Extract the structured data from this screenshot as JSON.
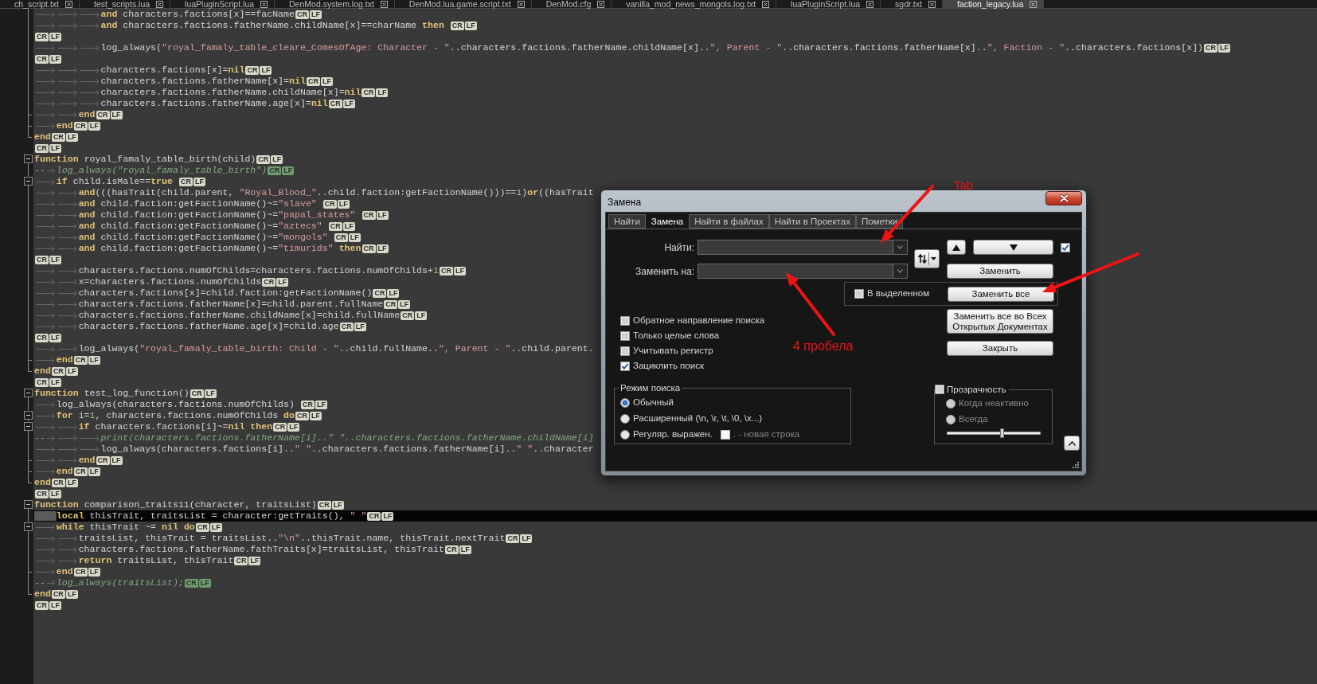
{
  "tabs": [
    {
      "label": "ch_script.txt",
      "selected": false
    },
    {
      "label": "test_scripts.lua",
      "selected": false
    },
    {
      "label": "luaPluginScript.lua",
      "selected": false
    },
    {
      "label": "DenMod.system.log.txt",
      "selected": false
    },
    {
      "label": "DenMod.lua.game.script.txt",
      "selected": false
    },
    {
      "label": "DenMod.cfg",
      "selected": false
    },
    {
      "label": "vanilla_mod_news_mongols.log.txt",
      "selected": false
    },
    {
      "label": "luaPluginScript.lua",
      "selected": false
    },
    {
      "label": "sgdr.txt",
      "selected": false
    },
    {
      "label": "faction_legacy.lua",
      "selected": true
    }
  ],
  "editor": {
    "lines": [
      {
        "kind": "code",
        "fold": {
          "kind": "guide"
        },
        "current": false,
        "tokens": [
          {
            "kind": "keyword",
            "text": "\t\t\tand"
          },
          {
            "kind": "plain",
            "text": " characters.factions[x]==facName"
          }
        ],
        "eol": [
          "CR",
          "LF"
        ]
      },
      {
        "kind": "code",
        "fold": {
          "kind": "guide"
        },
        "current": false,
        "tokens": [
          {
            "kind": "keyword",
            "text": "\t\t\tand"
          },
          {
            "kind": "plain",
            "text": " characters.factions.fatherName.childName[x]==charName "
          },
          {
            "kind": "keyword",
            "text": "then "
          }
        ],
        "eol": [
          "CR",
          "LF"
        ]
      },
      {
        "kind": "code",
        "fold": {
          "kind": "guide"
        },
        "current": false,
        "eol": [
          "CR",
          "LF"
        ]
      },
      {
        "kind": "code",
        "fold": {
          "kind": "guide"
        },
        "current": false,
        "tokens": [
          {
            "kind": "plain",
            "text": "\t\t\tlog_always("
          },
          {
            "kind": "string",
            "text": "\"royal_famaly_table_cleare_ComesOfAge: Character - \""
          },
          {
            "kind": "plain",
            "text": "..characters.factions.fatherName.childName[x].."
          },
          {
            "kind": "string",
            "text": "\", Parent - \""
          },
          {
            "kind": "plain",
            "text": "..characters.factions.fatherName[x].."
          },
          {
            "kind": "string",
            "text": "\", Faction - \""
          },
          {
            "kind": "plain",
            "text": "..characters.factions[x])"
          }
        ],
        "eol": [
          "CR",
          "LF"
        ]
      },
      {
        "kind": "code",
        "fold": {
          "kind": "guide"
        },
        "current": false,
        "eol": [
          "CR",
          "LF"
        ]
      },
      {
        "kind": "code",
        "fold": {
          "kind": "guide"
        },
        "current": false,
        "tokens": [
          {
            "kind": "plain",
            "text": "\t\t\tcharacters.factions[x]="
          },
          {
            "kind": "keyword",
            "text": "nil"
          }
        ],
        "eol": [
          "CR",
          "LF"
        ]
      },
      {
        "kind": "code",
        "fold": {
          "kind": "guide"
        },
        "current": false,
        "tokens": [
          {
            "kind": "plain",
            "text": "\t\t\tcharacters.factions.fatherName[x]="
          },
          {
            "kind": "keyword",
            "text": "nil"
          }
        ],
        "eol": [
          "CR",
          "LF"
        ]
      },
      {
        "kind": "code",
        "fold": {
          "kind": "guide"
        },
        "current": false,
        "tokens": [
          {
            "kind": "plain",
            "text": "\t\t\tcharacters.factions.fatherName.childName[x]="
          },
          {
            "kind": "keyword",
            "text": "nil"
          }
        ],
        "eol": [
          "CR",
          "LF"
        ]
      },
      {
        "kind": "code",
        "fold": {
          "kind": "guide"
        },
        "current": false,
        "tokens": [
          {
            "kind": "plain",
            "text": "\t\t\tcharacters.factions.fatherName.age[x]="
          },
          {
            "kind": "keyword",
            "text": "nil"
          }
        ],
        "eol": [
          "CR",
          "LF"
        ]
      },
      {
        "kind": "code",
        "fold": {
          "kind": "guide_tick"
        },
        "current": false,
        "tokens": [
          {
            "kind": "keyword",
            "text": "\t\tend"
          }
        ],
        "eol": [
          "CR",
          "LF"
        ]
      },
      {
        "kind": "code",
        "fold": {
          "kind": "guide_tick"
        },
        "current": false,
        "tokens": [
          {
            "kind": "keyword",
            "text": "\tend"
          }
        ],
        "eol": [
          "CR",
          "LF"
        ]
      },
      {
        "kind": "code",
        "fold": {
          "kind": "guide_end"
        },
        "current": false,
        "tokens": [
          {
            "kind": "keyword",
            "text": "end"
          }
        ],
        "eol": [
          "CR",
          "LF"
        ]
      },
      {
        "kind": "code",
        "current": false,
        "eol": [
          "CR",
          "LF"
        ]
      },
      {
        "kind": "code",
        "fold": {
          "kind": "collapse"
        },
        "current": false,
        "tokens": [
          {
            "kind": "keyword",
            "text": "function"
          },
          {
            "kind": "plain",
            "text": " royal_famaly_table_birth(child)"
          }
        ],
        "eol": [
          "CR",
          "LF"
        ]
      },
      {
        "kind": "comment",
        "fold": {
          "kind": "guide"
        },
        "current": false,
        "tokens": [
          {
            "kind": "comment",
            "text": "--\tlog_always(\"royal_famaly_table_birth\")"
          }
        ],
        "eol": [
          "CR",
          "LF"
        ]
      },
      {
        "kind": "code",
        "fold": {
          "kind": "collapse"
        },
        "current": false,
        "tokens": [
          {
            "kind": "keyword",
            "text": "\tif"
          },
          {
            "kind": "plain",
            "text": " child.isMale=="
          },
          {
            "kind": "keyword",
            "text": "true "
          }
        ],
        "eol": [
          "CR",
          "LF"
        ]
      },
      {
        "kind": "code",
        "fold": {
          "kind": "guide"
        },
        "current": false,
        "tokens": [
          {
            "kind": "keyword",
            "text": "\t\tand"
          },
          {
            "kind": "plain",
            "text": "(((hasTrait(child.parent, "
          },
          {
            "kind": "string",
            "text": "\"Royal_Blood_\""
          },
          {
            "kind": "plain",
            "text": "..child.faction:getFactionName()))=="
          },
          {
            "kind": "number",
            "text": "1"
          },
          {
            "kind": "plain",
            "text": ")"
          },
          {
            "kind": "keyword",
            "text": "or"
          },
          {
            "kind": "plain",
            "text": "((hasTrait"
          }
        ]
      },
      {
        "kind": "code",
        "fold": {
          "kind": "guide"
        },
        "current": false,
        "tokens": [
          {
            "kind": "keyword",
            "text": "\t\tand"
          },
          {
            "kind": "plain",
            "text": " child.faction:getFactionName()~="
          },
          {
            "kind": "string",
            "text": "\"slave\" "
          }
        ],
        "eol": [
          "CR",
          "LF"
        ]
      },
      {
        "kind": "code",
        "fold": {
          "kind": "guide"
        },
        "current": false,
        "tokens": [
          {
            "kind": "keyword",
            "text": "\t\tand"
          },
          {
            "kind": "plain",
            "text": " child.faction:getFactionName()~="
          },
          {
            "kind": "string",
            "text": "\"papal_states\" "
          }
        ],
        "eol": [
          "CR",
          "LF"
        ]
      },
      {
        "kind": "code",
        "fold": {
          "kind": "guide"
        },
        "current": false,
        "tokens": [
          {
            "kind": "keyword",
            "text": "\t\tand"
          },
          {
            "kind": "plain",
            "text": " child.faction:getFactionName()~="
          },
          {
            "kind": "string",
            "text": "\"aztecs\" "
          }
        ],
        "eol": [
          "CR",
          "LF"
        ]
      },
      {
        "kind": "code",
        "fold": {
          "kind": "guide"
        },
        "current": false,
        "tokens": [
          {
            "kind": "keyword",
            "text": "\t\tand"
          },
          {
            "kind": "plain",
            "text": " child.faction:getFactionName()~="
          },
          {
            "kind": "string",
            "text": "\"mongols\" "
          }
        ],
        "eol": [
          "CR",
          "LF"
        ]
      },
      {
        "kind": "code",
        "fold": {
          "kind": "guide"
        },
        "current": false,
        "tokens": [
          {
            "kind": "keyword",
            "text": "\t\tand"
          },
          {
            "kind": "plain",
            "text": " child.faction:getFactionName()~="
          },
          {
            "kind": "string",
            "text": "\"timurids\" "
          },
          {
            "kind": "keyword",
            "text": "then"
          }
        ],
        "eol": [
          "CR",
          "LF"
        ]
      },
      {
        "kind": "code",
        "fold": {
          "kind": "guide"
        },
        "current": false,
        "eol": [
          "CR",
          "LF"
        ]
      },
      {
        "kind": "code",
        "fold": {
          "kind": "guide"
        },
        "current": false,
        "tokens": [
          {
            "kind": "plain",
            "text": "\t\tcharacters.factions.numOfChilds=characters.factions.numOfChilds+"
          },
          {
            "kind": "number",
            "text": "1"
          }
        ],
        "eol": [
          "CR",
          "LF"
        ]
      },
      {
        "kind": "code",
        "fold": {
          "kind": "guide"
        },
        "current": false,
        "tokens": [
          {
            "kind": "plain",
            "text": "\t\tx=characters.factions.numOfChilds"
          }
        ],
        "eol": [
          "CR",
          "LF"
        ]
      },
      {
        "kind": "code",
        "fold": {
          "kind": "guide"
        },
        "current": false,
        "tokens": [
          {
            "kind": "plain",
            "text": "\t\tcharacters.factions[x]=child.faction:getFactionName()"
          }
        ],
        "eol": [
          "CR",
          "LF"
        ]
      },
      {
        "kind": "code",
        "fold": {
          "kind": "guide"
        },
        "current": false,
        "tokens": [
          {
            "kind": "plain",
            "text": "\t\tcharacters.factions.fatherName[x]=child.parent.fullName"
          }
        ],
        "eol": [
          "CR",
          "LF"
        ]
      },
      {
        "kind": "code",
        "fold": {
          "kind": "guide"
        },
        "current": false,
        "tokens": [
          {
            "kind": "plain",
            "text": "\t\tcharacters.factions.fatherName.childName[x]=child.fullName"
          }
        ],
        "eol": [
          "CR",
          "LF"
        ]
      },
      {
        "kind": "code",
        "fold": {
          "kind": "guide"
        },
        "current": false,
        "tokens": [
          {
            "kind": "plain",
            "text": "\t\tcharacters.factions.fatherName.age[x]=child.age"
          }
        ],
        "eol": [
          "CR",
          "LF"
        ]
      },
      {
        "kind": "code",
        "fold": {
          "kind": "guide"
        },
        "current": false,
        "eol": [
          "CR",
          "LF"
        ]
      },
      {
        "kind": "code",
        "fold": {
          "kind": "guide"
        },
        "current": false,
        "tokens": [
          {
            "kind": "plain",
            "text": "\t\tlog_always("
          },
          {
            "kind": "string",
            "text": "\"royal_famaly_table_birth: Child - \""
          },
          {
            "kind": "plain",
            "text": "..child.fullName.."
          },
          {
            "kind": "string",
            "text": "\", Parent - \""
          },
          {
            "kind": "plain",
            "text": "..child.parent."
          }
        ]
      },
      {
        "kind": "code",
        "fold": {
          "kind": "guide_tick"
        },
        "current": false,
        "tokens": [
          {
            "kind": "keyword",
            "text": "\tend"
          }
        ],
        "eol": [
          "CR",
          "LF"
        ]
      },
      {
        "kind": "code",
        "fold": {
          "kind": "guide_end"
        },
        "current": false,
        "tokens": [
          {
            "kind": "keyword",
            "text": "end"
          }
        ],
        "eol": [
          "CR",
          "LF"
        ]
      },
      {
        "kind": "code",
        "current": false,
        "eol": [
          "CR",
          "LF"
        ]
      },
      {
        "kind": "code",
        "fold": {
          "kind": "collapse"
        },
        "current": false,
        "tokens": [
          {
            "kind": "keyword",
            "text": "function"
          },
          {
            "kind": "plain",
            "text": " test_log_function()"
          }
        ],
        "eol": [
          "CR",
          "LF"
        ]
      },
      {
        "kind": "code",
        "fold": {
          "kind": "guide"
        },
        "current": false,
        "tokens": [
          {
            "kind": "plain",
            "text": "\tlog_always(characters.factions.numOfChilds) "
          }
        ],
        "eol": [
          "CR",
          "LF"
        ]
      },
      {
        "kind": "code",
        "fold": {
          "kind": "collapse"
        },
        "current": false,
        "tokens": [
          {
            "kind": "keyword",
            "text": "\tfor"
          },
          {
            "kind": "plain",
            "text": " i="
          },
          {
            "kind": "number",
            "text": "1"
          },
          {
            "kind": "plain",
            "text": ", characters.factions.numOfChilds "
          },
          {
            "kind": "keyword",
            "text": "do"
          }
        ],
        "eol": [
          "CR",
          "LF"
        ]
      },
      {
        "kind": "code",
        "fold": {
          "kind": "collapse"
        },
        "current": false,
        "tokens": [
          {
            "kind": "keyword",
            "text": "\t\tif"
          },
          {
            "kind": "plain",
            "text": " characters.factions[i]~="
          },
          {
            "kind": "keyword",
            "text": "nil "
          },
          {
            "kind": "keyword",
            "text": "then"
          }
        ],
        "eol": [
          "CR",
          "LF"
        ]
      },
      {
        "kind": "comment",
        "fold": {
          "kind": "guide"
        },
        "current": false,
        "tokens": [
          {
            "kind": "comment",
            "text": "--\t\t\tprint(characters.factions.fatherName[i]..\" \"..characters.factions.fatherName.childName[i]"
          }
        ]
      },
      {
        "kind": "code",
        "fold": {
          "kind": "guide"
        },
        "current": false,
        "tokens": [
          {
            "kind": "plain",
            "text": "\t\t\tlog_always(characters.factions[i].."
          },
          {
            "kind": "string",
            "text": "\" \""
          },
          {
            "kind": "plain",
            "text": "..characters.factions.fatherName[i].."
          },
          {
            "kind": "string",
            "text": "\" \""
          },
          {
            "kind": "plain",
            "text": "..character"
          }
        ]
      },
      {
        "kind": "code",
        "fold": {
          "kind": "guide_tick"
        },
        "current": false,
        "tokens": [
          {
            "kind": "keyword",
            "text": "\t\tend"
          }
        ],
        "eol": [
          "CR",
          "LF"
        ]
      },
      {
        "kind": "code",
        "fold": {
          "kind": "guide_tick"
        },
        "current": false,
        "tokens": [
          {
            "kind": "keyword",
            "text": "\tend"
          }
        ],
        "eol": [
          "CR",
          "LF"
        ]
      },
      {
        "kind": "code",
        "fold": {
          "kind": "guide_end"
        },
        "current": false,
        "tokens": [
          {
            "kind": "keyword",
            "text": "end"
          }
        ],
        "eol": [
          "CR",
          "LF"
        ]
      },
      {
        "kind": "code",
        "current": false,
        "eol": [
          "CR",
          "LF"
        ]
      },
      {
        "kind": "code",
        "fold": {
          "kind": "collapse"
        },
        "current": false,
        "tokens": [
          {
            "kind": "keyword",
            "text": "function"
          },
          {
            "kind": "plain",
            "text": " comparison_traits11(character, traitsList)"
          }
        ],
        "eol": [
          "CR",
          "LF"
        ]
      },
      {
        "kind": "code",
        "fold": {
          "kind": "guide"
        },
        "current": true,
        "tokens": [
          {
            "kind": "keyword",
            "text": "\tlocal"
          },
          {
            "kind": "plain",
            "text": " thisTrait, traitsList = character:getTraits(), "
          },
          {
            "kind": "string",
            "text": "\" \""
          }
        ],
        "eol": [
          "CR",
          "LF"
        ]
      },
      {
        "kind": "code",
        "fold": {
          "kind": "collapse"
        },
        "current": false,
        "tokens": [
          {
            "kind": "keyword",
            "text": "\twhile"
          },
          {
            "kind": "plain",
            "text": " thisTrait ~= "
          },
          {
            "kind": "keyword",
            "text": "nil "
          },
          {
            "kind": "keyword",
            "text": "do"
          }
        ],
        "eol": [
          "CR",
          "LF"
        ]
      },
      {
        "kind": "code",
        "fold": {
          "kind": "guide"
        },
        "current": false,
        "tokens": [
          {
            "kind": "plain",
            "text": "\t\ttraitsList, thisTrait = traitsList.."
          },
          {
            "kind": "string",
            "text": "\"\\n\""
          },
          {
            "kind": "plain",
            "text": "..thisTrait.name, thisTrait.nextTrait"
          }
        ],
        "eol": [
          "CR",
          "LF"
        ]
      },
      {
        "kind": "code",
        "fold": {
          "kind": "guide"
        },
        "current": false,
        "tokens": [
          {
            "kind": "plain",
            "text": "\t\tcharacters.factions.fatherName.fathTraits[x]=traitsList, thisTrait"
          }
        ],
        "eol": [
          "CR",
          "LF"
        ]
      },
      {
        "kind": "code",
        "fold": {
          "kind": "guide"
        },
        "current": false,
        "tokens": [
          {
            "kind": "keyword",
            "text": "\t\treturn"
          },
          {
            "kind": "plain",
            "text": " traitsList, thisTrait"
          }
        ],
        "eol": [
          "CR",
          "LF"
        ]
      },
      {
        "kind": "code",
        "fold": {
          "kind": "guide_tick"
        },
        "current": false,
        "tokens": [
          {
            "kind": "keyword",
            "text": "\tend"
          }
        ],
        "eol": [
          "CR",
          "LF"
        ]
      },
      {
        "kind": "comment",
        "fold": {
          "kind": "guide"
        },
        "current": false,
        "tokens": [
          {
            "kind": "comment",
            "text": "--\tlog_always(traitsList);"
          }
        ],
        "eol": [
          "CR",
          "LF"
        ]
      },
      {
        "kind": "code",
        "fold": {
          "kind": "guide_end"
        },
        "current": false,
        "tokens": [
          {
            "kind": "keyword",
            "text": "end"
          }
        ],
        "eol": [
          "CR",
          "LF"
        ]
      },
      {
        "kind": "code",
        "current": false,
        "eol": [
          "CR",
          "LF"
        ]
      }
    ]
  },
  "dialog": {
    "title": "Замена",
    "tabs": [
      {
        "label": "Найти",
        "selected": false
      },
      {
        "label": "Замена",
        "selected": true
      },
      {
        "label": "Найти в файлах",
        "selected": false
      },
      {
        "label": "Найти в Проектах",
        "selected": false
      },
      {
        "label": "Пометки",
        "selected": false
      }
    ],
    "fields": [
      {
        "label": "Найти:"
      },
      {
        "label": "Заменить на:"
      }
    ],
    "unlabeled_checkbox": {
      "checked": true
    },
    "replace_button": "Заменить",
    "in_selection": {
      "label": "В выделенном",
      "checked": false
    },
    "replace_all_button": "Заменить все",
    "replace_all_open_documents_button": "Заменить все во Всех Открытых Документах",
    "close_button": "Закрыть",
    "options": [
      {
        "label": "Обратное направление поиска",
        "checked": false
      },
      {
        "label": "Только целые слова",
        "checked": false
      },
      {
        "label": "Учитывать регистр",
        "checked": false
      },
      {
        "label": "Зациклить поиск",
        "checked": true
      }
    ],
    "search_mode": {
      "title": "Режим поиска",
      "options": [
        {
          "label": "Обычный",
          "selected": true
        },
        {
          "label": "Расширенный (\\n, \\r, \\t, \\0, \\x...)",
          "selected": false
        },
        {
          "label": "Регуляр. выражен.",
          "selected": false,
          "extra_checkbox": {
            "label": ". - новая строка",
            "checked": false,
            "disabled": true
          }
        }
      ]
    },
    "transparency": {
      "label": "Прозрачность",
      "checked": false,
      "options": [
        {
          "label": "Когда неактивно",
          "selected": false,
          "disabled": true
        },
        {
          "label": "Всегда",
          "selected": false,
          "disabled": true
        }
      ],
      "slider": {
        "level": 0.59
      }
    }
  },
  "annotations": [
    {
      "text": "Tab"
    },
    {
      "text": "4 пробела"
    }
  ]
}
